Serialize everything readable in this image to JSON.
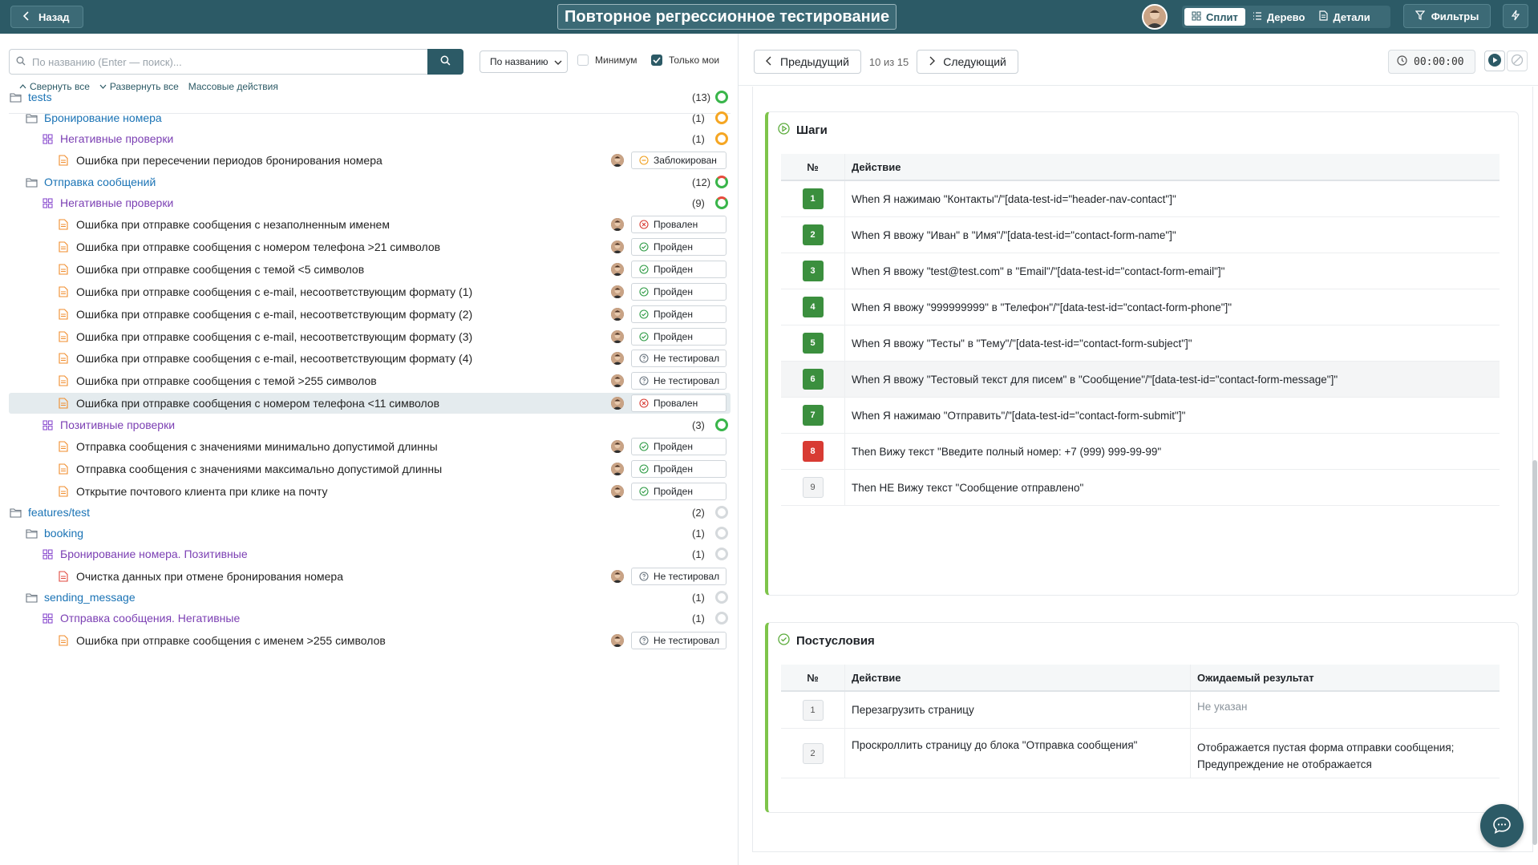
{
  "header": {
    "back_label": "Назад",
    "title": "Повторное регрессионное тестирование",
    "views": [
      {
        "label": "Сплит",
        "icon": "split-icon",
        "active": true
      },
      {
        "label": "Дерево",
        "icon": "list-icon",
        "active": false
      },
      {
        "label": "Детали",
        "icon": "document-icon",
        "active": false
      }
    ],
    "filters_label": "Фильтры"
  },
  "left": {
    "search_placeholder": "По названию (Enter — поиск)...",
    "sort_value": "По названию",
    "minimum_label": "Минимум",
    "minimum_checked": false,
    "only_mine_label": "Только мои",
    "only_mine_checked": true,
    "collapse_all": "Свернуть все",
    "expand_all": "Развернуть все",
    "mass_actions": "Массовые действия",
    "tree": [
      {
        "type": "folder",
        "level": 0,
        "label": "tests",
        "count": "(13)",
        "ring": "green"
      },
      {
        "type": "folder",
        "level": 1,
        "label": "Бронирование номера",
        "count": "(1)",
        "ring": "orange"
      },
      {
        "type": "suite",
        "level": 2,
        "label": "Негативные проверки",
        "count": "(1)",
        "ring": "orange"
      },
      {
        "type": "case",
        "level": 3,
        "label": "Ошибка при пересечении периодов бронирования номера",
        "status": "Заблокирован",
        "status_kind": "blocked"
      },
      {
        "type": "folder",
        "level": 1,
        "label": "Отправка сообщений",
        "count": "(12)",
        "ring": "green-red"
      },
      {
        "type": "suite",
        "level": 2,
        "label": "Негативные проверки",
        "count": "(9)",
        "ring": "green-red"
      },
      {
        "type": "case",
        "level": 3,
        "label": "Ошибка при отправке сообщения с незаполненным именем",
        "status": "Провален",
        "status_kind": "failed"
      },
      {
        "type": "case",
        "level": 3,
        "label": "Ошибка при отправке сообщения с номером телефона >21 символов",
        "status": "Пройден",
        "status_kind": "passed"
      },
      {
        "type": "case",
        "level": 3,
        "label": "Ошибка при отправке сообщения с темой <5 символов",
        "status": "Пройден",
        "status_kind": "passed"
      },
      {
        "type": "case",
        "level": 3,
        "label": "Ошибка при отправке сообщения с e-mail, несоответствующим формату (1)",
        "status": "Пройден",
        "status_kind": "passed"
      },
      {
        "type": "case",
        "level": 3,
        "label": "Ошибка при отправке сообщения с e-mail, несоответствующим формату (2)",
        "status": "Пройден",
        "status_kind": "passed"
      },
      {
        "type": "case",
        "level": 3,
        "label": "Ошибка при отправке сообщения с e-mail, несоответствующим формату (3)",
        "status": "Пройден",
        "status_kind": "passed"
      },
      {
        "type": "case",
        "level": 3,
        "label": "Ошибка при отправке сообщения с e-mail, несоответствующим формату (4)",
        "status": "Не тестировал",
        "status_kind": "untested"
      },
      {
        "type": "case",
        "level": 3,
        "label": "Ошибка при отправке сообщения с темой >255 символов",
        "status": "Не тестировал",
        "status_kind": "untested"
      },
      {
        "type": "case",
        "level": 3,
        "label": "Ошибка при отправке сообщения с номером телефона <11 символов",
        "status": "Провален",
        "status_kind": "failed",
        "selected": true
      },
      {
        "type": "suite",
        "level": 2,
        "label": "Позитивные проверки",
        "count": "(3)",
        "ring": "green"
      },
      {
        "type": "case",
        "level": 3,
        "label": "Отправка сообщения с значениями минимально допустимой длинны",
        "status": "Пройден",
        "status_kind": "passed"
      },
      {
        "type": "case",
        "level": 3,
        "label": "Отправка сообщения с значениями максимально допустимой длинны",
        "status": "Пройден",
        "status_kind": "passed"
      },
      {
        "type": "case",
        "level": 3,
        "label": "Открытие почтового клиента при клике на почту",
        "status": "Пройден",
        "status_kind": "passed"
      },
      {
        "type": "folder",
        "level": 0,
        "label": "features/test",
        "count": "(2)",
        "ring": "gray"
      },
      {
        "type": "folder",
        "level": 1,
        "label": "booking",
        "count": "(1)",
        "ring": "gray"
      },
      {
        "type": "suite",
        "level": 2,
        "label": "Бронирование номера. Позитивные",
        "count": "(1)",
        "ring": "gray"
      },
      {
        "type": "case",
        "level": 3,
        "label": "Очистка данных при отмене бронирования номера",
        "status": "Не тестировал",
        "status_kind": "untested",
        "icon_color": "red"
      },
      {
        "type": "folder",
        "level": 1,
        "label": "sending_message",
        "count": "(1)",
        "ring": "gray"
      },
      {
        "type": "suite",
        "level": 2,
        "label": "Отправка сообщения. Негативные",
        "count": "(1)",
        "ring": "gray"
      },
      {
        "type": "case",
        "level": 3,
        "label": "Ошибка при отправке сообщения с именем >255 символов",
        "status": "Не тестировал",
        "status_kind": "untested"
      }
    ]
  },
  "right": {
    "prev_label": "Предыдущий",
    "position": "10 из 15",
    "next_label": "Следующий",
    "timer": "00:00:00",
    "steps": {
      "title": "Шаги",
      "col_num": "№",
      "col_action": "Действие",
      "rows": [
        {
          "num": "1",
          "kind": "green",
          "action": "When Я нажимаю \"Контакты\"/\"[data-test-id=\"header-nav-contact\"]\""
        },
        {
          "num": "2",
          "kind": "green",
          "action": "When Я ввожу \"Иван\" в \"Имя\"/\"[data-test-id=\"contact-form-name\"]\""
        },
        {
          "num": "3",
          "kind": "green",
          "action": "When Я ввожу \"test@test.com\" в \"Email\"/\"[data-test-id=\"contact-form-email\"]\""
        },
        {
          "num": "4",
          "kind": "green",
          "action": "When Я ввожу \"999999999\" в \"Телефон\"/\"[data-test-id=\"contact-form-phone\"]\""
        },
        {
          "num": "5",
          "kind": "green",
          "action": "When Я ввожу \"Тесты\" в \"Тему\"/\"[data-test-id=\"contact-form-subject\"]\""
        },
        {
          "num": "6",
          "kind": "green",
          "action": "When Я ввожу \"Тестовый текст для писем\" в \"Сообщение\"/\"[data-test-id=\"contact-form-message\"]\"",
          "highlight": true
        },
        {
          "num": "7",
          "kind": "green",
          "action": "When Я нажимаю \"Отправить\"/\"[data-test-id=\"contact-form-submit\"]\""
        },
        {
          "num": "8",
          "kind": "red",
          "action": "Then Вижу текст \"Введите полный номер: +7 (999) 999-99-99\""
        },
        {
          "num": "9",
          "kind": "gray",
          "action": "Then НЕ Вижу текст \"Сообщение отправлено\""
        }
      ]
    },
    "post": {
      "title": "Постусловия",
      "col_num": "№",
      "col_action": "Действие",
      "col_expected": "Ожидаемый результат",
      "rows": [
        {
          "num": "1",
          "action": "Перезагрузить страницу",
          "expected": "Не указан",
          "expected_muted": true
        },
        {
          "num": "2",
          "action": "Проскроллить страницу до блока \"Отправка сообщения\"",
          "expected": "Отображается пустая форма отправки сообщения; Предупреждение не отображается",
          "expected_muted": false
        }
      ]
    }
  }
}
